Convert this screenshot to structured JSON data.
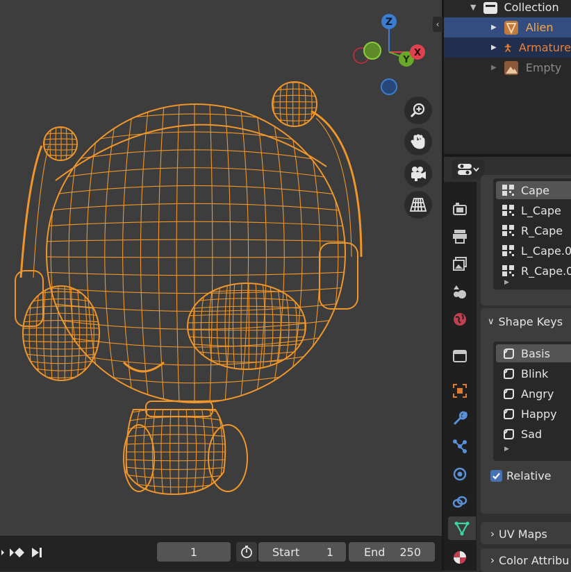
{
  "outliner": {
    "items": [
      {
        "label": "Collection",
        "icon": "collection-icon",
        "color": "#e6e6e6"
      },
      {
        "label": "Alien",
        "icon": "mesh-object-icon",
        "color": "#f0a850"
      },
      {
        "label": "Armature",
        "icon": "armature-icon",
        "color": "#f08030"
      },
      {
        "label": "Empty",
        "icon": "image-empty-icon",
        "color": "#8a8a8a"
      }
    ]
  },
  "properties": {
    "vertex_groups": [
      "Cape",
      "L_Cape",
      "R_Cape",
      "L_Cape.0",
      "R_Cape.0"
    ],
    "shape_keys_title": "Shape Keys",
    "shape_keys": [
      "Basis",
      "Blink",
      "Angry",
      "Happy",
      "Sad"
    ],
    "relative_label": "Relative",
    "relative_checked": true,
    "uv_maps_title": "UV Maps",
    "color_attr_title": "Color Attribu"
  },
  "gizmo": {
    "z": "Z",
    "x": "X",
    "y": "Y"
  },
  "timeline": {
    "current_frame": "1",
    "start_label": "Start",
    "start_value": "1",
    "end_label": "End",
    "end_value": "250"
  },
  "colors": {
    "wire": "#f0962a",
    "selected_row": "#334d80",
    "accent": "#4772b3"
  }
}
